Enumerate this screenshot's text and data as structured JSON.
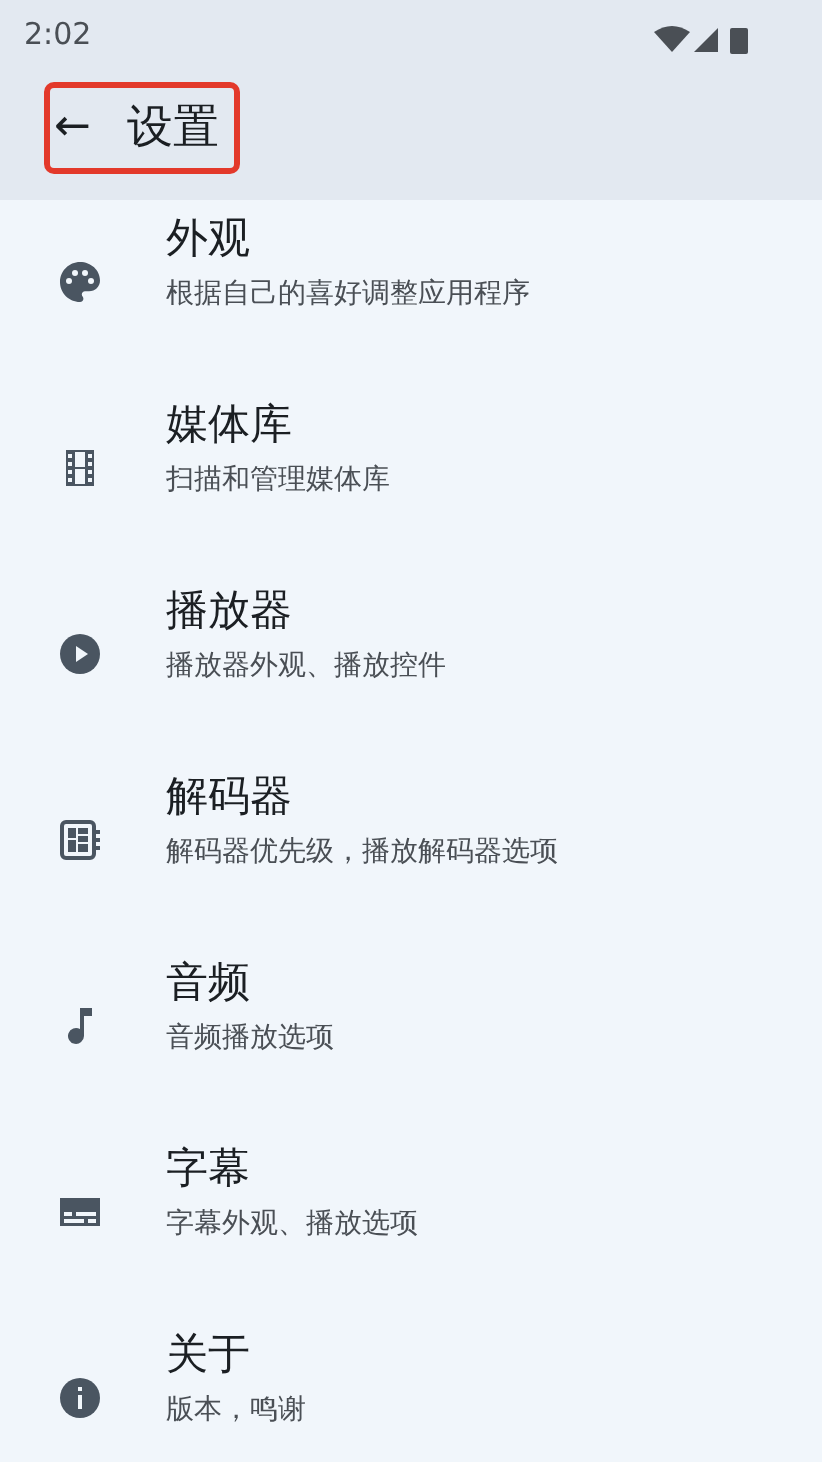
{
  "status_bar": {
    "time": "2:02"
  },
  "app_bar": {
    "back": "←",
    "title": "设置",
    "highlighted": true
  },
  "items": [
    {
      "title": "外观",
      "subtitle": "根据自己的喜好调整应用程序"
    },
    {
      "title": "媒体库",
      "subtitle": "扫描和管理媒体库"
    },
    {
      "title": "播放器",
      "subtitle": "播放器外观、播放控件"
    },
    {
      "title": "解码器",
      "subtitle": "解码器优先级，播放解码器选项"
    },
    {
      "title": "音频",
      "subtitle": "音频播放选项"
    },
    {
      "title": "字幕",
      "subtitle": "字幕外观、播放选项"
    },
    {
      "title": "关于",
      "subtitle": "版本，鸣谢"
    }
  ]
}
